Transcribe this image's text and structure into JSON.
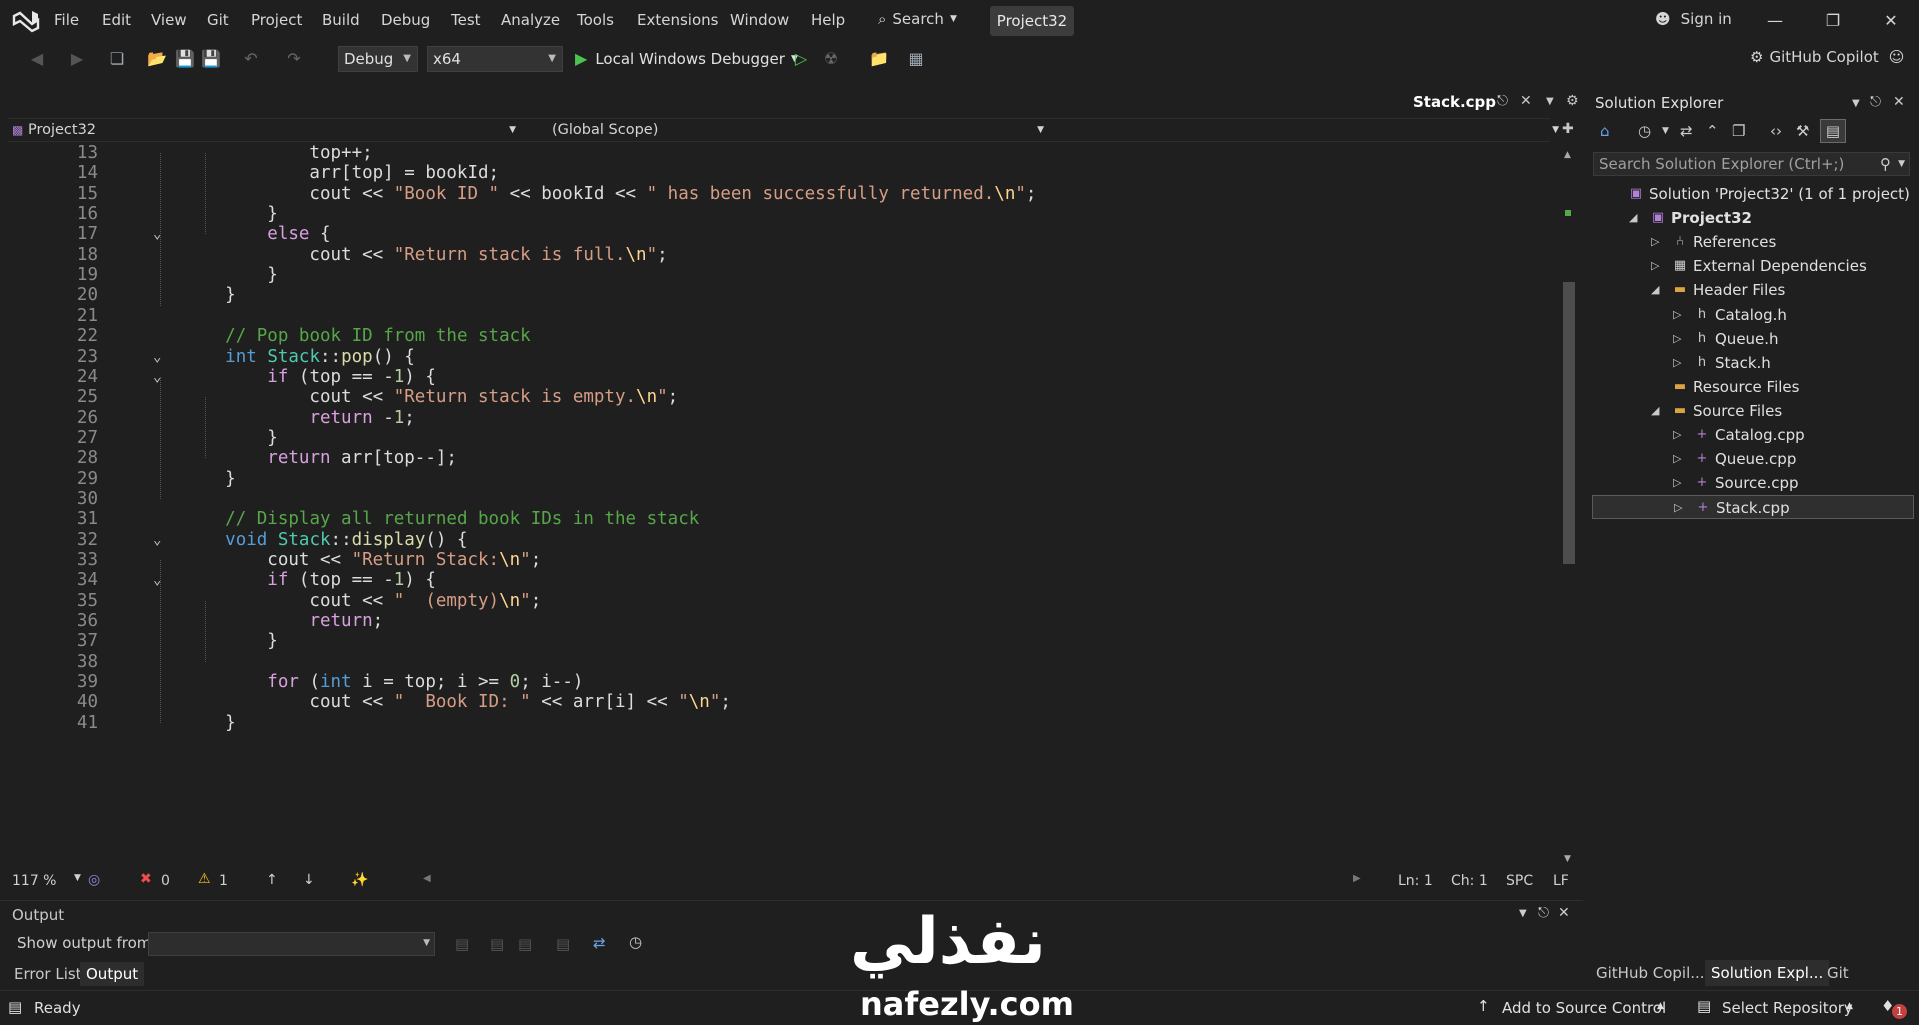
{
  "menubar": {
    "items": [
      "File",
      "Edit",
      "View",
      "Git",
      "Project",
      "Build",
      "Debug",
      "Test",
      "Analyze",
      "Tools",
      "Extensions",
      "Window",
      "Help"
    ],
    "search_label": "Search",
    "project_name": "Project32",
    "signin_label": "Sign in"
  },
  "toolbar": {
    "config": "Debug",
    "platform": "x64",
    "run_label": "Local Windows Debugger",
    "copilot_label": "GitHub Copilot"
  },
  "editor": {
    "tab_title": "Stack.cpp",
    "nav_project": "Project32",
    "nav_scope": "(Global Scope)",
    "zoom": "117 %",
    "errors": "0",
    "warnings": "1",
    "line": "Ln: 1",
    "col": "Ch: 1",
    "whitespace": "SPC",
    "eol": "LF",
    "lines": [
      {
        "n": "13",
        "fold": "",
        "html": "            top++;"
      },
      {
        "n": "14",
        "fold": "",
        "html": "            arr[top] = bookId;"
      },
      {
        "n": "15",
        "fold": "",
        "html": "            cout << \"Book ID \" << bookId << \" has been successfully returned.\\n\";"
      },
      {
        "n": "16",
        "fold": "",
        "html": "        }"
      },
      {
        "n": "17",
        "fold": "v",
        "html": "        else {"
      },
      {
        "n": "18",
        "fold": "",
        "html": "            cout << \"Return stack is full.\\n\";"
      },
      {
        "n": "19",
        "fold": "",
        "html": "        }"
      },
      {
        "n": "20",
        "fold": "",
        "html": "    }"
      },
      {
        "n": "21",
        "fold": "",
        "html": ""
      },
      {
        "n": "22",
        "fold": "",
        "html": "    // Pop book ID from the stack"
      },
      {
        "n": "23",
        "fold": "v",
        "html": "    int Stack::pop() {"
      },
      {
        "n": "24",
        "fold": "v",
        "html": "        if (top == -1) {"
      },
      {
        "n": "25",
        "fold": "",
        "html": "            cout << \"Return stack is empty.\\n\";"
      },
      {
        "n": "26",
        "fold": "",
        "html": "            return -1;"
      },
      {
        "n": "27",
        "fold": "",
        "html": "        }"
      },
      {
        "n": "28",
        "fold": "",
        "html": "        return arr[top--];"
      },
      {
        "n": "29",
        "fold": "",
        "html": "    }"
      },
      {
        "n": "30",
        "fold": "",
        "html": ""
      },
      {
        "n": "31",
        "fold": "",
        "html": "    // Display all returned book IDs in the stack"
      },
      {
        "n": "32",
        "fold": "v",
        "html": "    void Stack::display() {"
      },
      {
        "n": "33",
        "fold": "",
        "html": "        cout << \"Return Stack:\\n\";"
      },
      {
        "n": "34",
        "fold": "v",
        "html": "        if (top == -1) {"
      },
      {
        "n": "35",
        "fold": "",
        "html": "            cout << \"  (empty)\\n\";"
      },
      {
        "n": "36",
        "fold": "",
        "html": "            return;"
      },
      {
        "n": "37",
        "fold": "",
        "html": "        }"
      },
      {
        "n": "38",
        "fold": "",
        "html": ""
      },
      {
        "n": "39",
        "fold": "",
        "html": "        for (int i = top; i >= 0; i--)"
      },
      {
        "n": "40",
        "fold": "",
        "html": "            cout << \"  Book ID: \" << arr[i] << \"\\n\";"
      },
      {
        "n": "41",
        "fold": "",
        "html": "    }"
      }
    ]
  },
  "output": {
    "title": "Output",
    "show_from_label": "Show output from:",
    "tabs": [
      "Error List",
      "Output"
    ]
  },
  "solution_explorer": {
    "title": "Solution Explorer",
    "search_placeholder": "Search Solution Explorer (Ctrl+;)",
    "tree": [
      {
        "label": "Solution 'Project32' (1 of 1 project)",
        "depth": 0,
        "chev": "",
        "icon": "solution"
      },
      {
        "label": "Project32",
        "depth": 1,
        "chev": "open",
        "icon": "project",
        "bold": true
      },
      {
        "label": "References",
        "depth": 2,
        "chev": "closed",
        "icon": "references"
      },
      {
        "label": "External Dependencies",
        "depth": 2,
        "chev": "closed",
        "icon": "external"
      },
      {
        "label": "Header Files",
        "depth": 2,
        "chev": "open",
        "icon": "folder"
      },
      {
        "label": "Catalog.h",
        "depth": 3,
        "chev": "closed",
        "icon": "header"
      },
      {
        "label": "Queue.h",
        "depth": 3,
        "chev": "closed",
        "icon": "header"
      },
      {
        "label": "Stack.h",
        "depth": 3,
        "chev": "closed",
        "icon": "header"
      },
      {
        "label": "Resource Files",
        "depth": 2,
        "chev": "",
        "icon": "folder"
      },
      {
        "label": "Source Files",
        "depth": 2,
        "chev": "open",
        "icon": "folder"
      },
      {
        "label": "Catalog.cpp",
        "depth": 3,
        "chev": "closed",
        "icon": "cpp"
      },
      {
        "label": "Queue.cpp",
        "depth": 3,
        "chev": "closed",
        "icon": "cpp"
      },
      {
        "label": "Source.cpp",
        "depth": 3,
        "chev": "closed",
        "icon": "cpp"
      },
      {
        "label": "Stack.cpp",
        "depth": 3,
        "chev": "closed",
        "icon": "cpp",
        "selected": true
      }
    ],
    "tabs": [
      "GitHub Copil...",
      "Solution Expl...",
      "Git Changes"
    ]
  },
  "statusbar": {
    "ready": "Ready",
    "source_control": "Add to Source Control",
    "repository": "Select Repository",
    "notifications": "1"
  },
  "watermark": {
    "arabic": "نفذلي",
    "latin": "nafezly.com"
  }
}
